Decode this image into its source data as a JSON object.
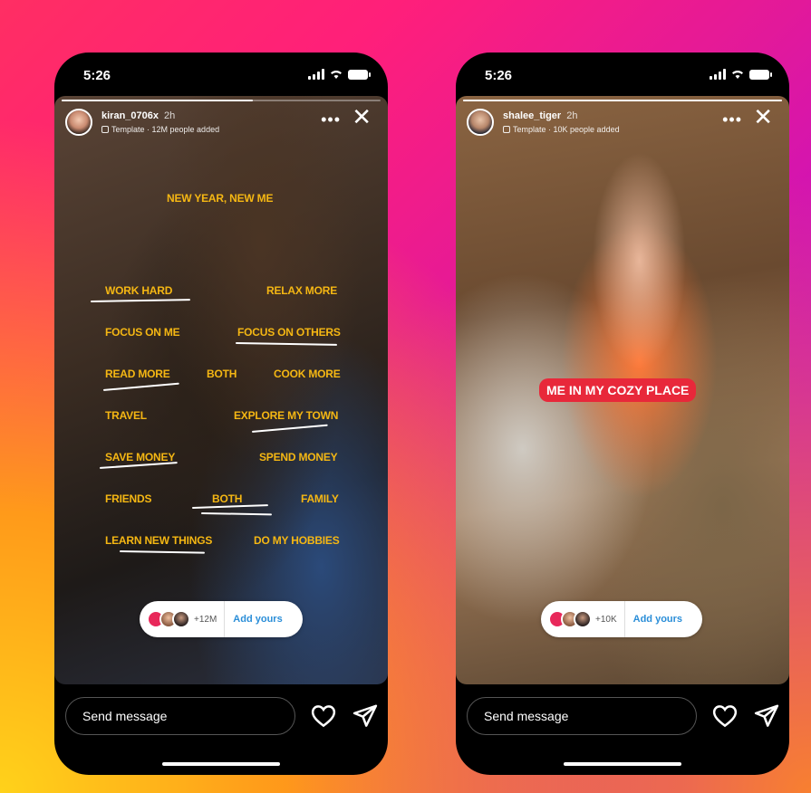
{
  "colors": {
    "template_text": "#f5b713",
    "sticker_red": "#e8283a",
    "add_yours_blue": "#2a8ed8"
  },
  "left_story": {
    "status_time": "5:26",
    "username": "kiran_0706x",
    "age": "2h",
    "template_label": "Template · 12M people added",
    "progress": 0.6,
    "options": [
      "NEW YEAR, NEW ME",
      "WORK HARD",
      "RELAX MORE",
      "FOCUS ON ME",
      "FOCUS ON OTHERS",
      "READ MORE",
      "BOTH",
      "COOK MORE",
      "TRAVEL",
      "EXPLORE MY TOWN",
      "SAVE MONEY",
      "SPEND MONEY",
      "FRIENDS",
      "BOTH",
      "FAMILY",
      "LEARN NEW THINGS",
      "DO MY HOBBIES"
    ],
    "added_count": "+12M",
    "add_yours": "Add yours",
    "message_placeholder": "Send message",
    "icons": {
      "like": "heart-icon",
      "share": "paper-plane-icon",
      "more": "more-dots-icon",
      "close": "close-icon"
    }
  },
  "right_story": {
    "status_time": "5:26",
    "username": "shalee_tiger",
    "age": "2h",
    "template_label": "Template · 10K people added",
    "progress": 1.0,
    "sticker": "ME IN MY COZY PLACE",
    "added_count": "+10K",
    "add_yours": "Add yours",
    "message_placeholder": "Send message",
    "icons": {
      "like": "heart-icon",
      "share": "paper-plane-icon",
      "more": "more-dots-icon",
      "close": "close-icon"
    }
  }
}
